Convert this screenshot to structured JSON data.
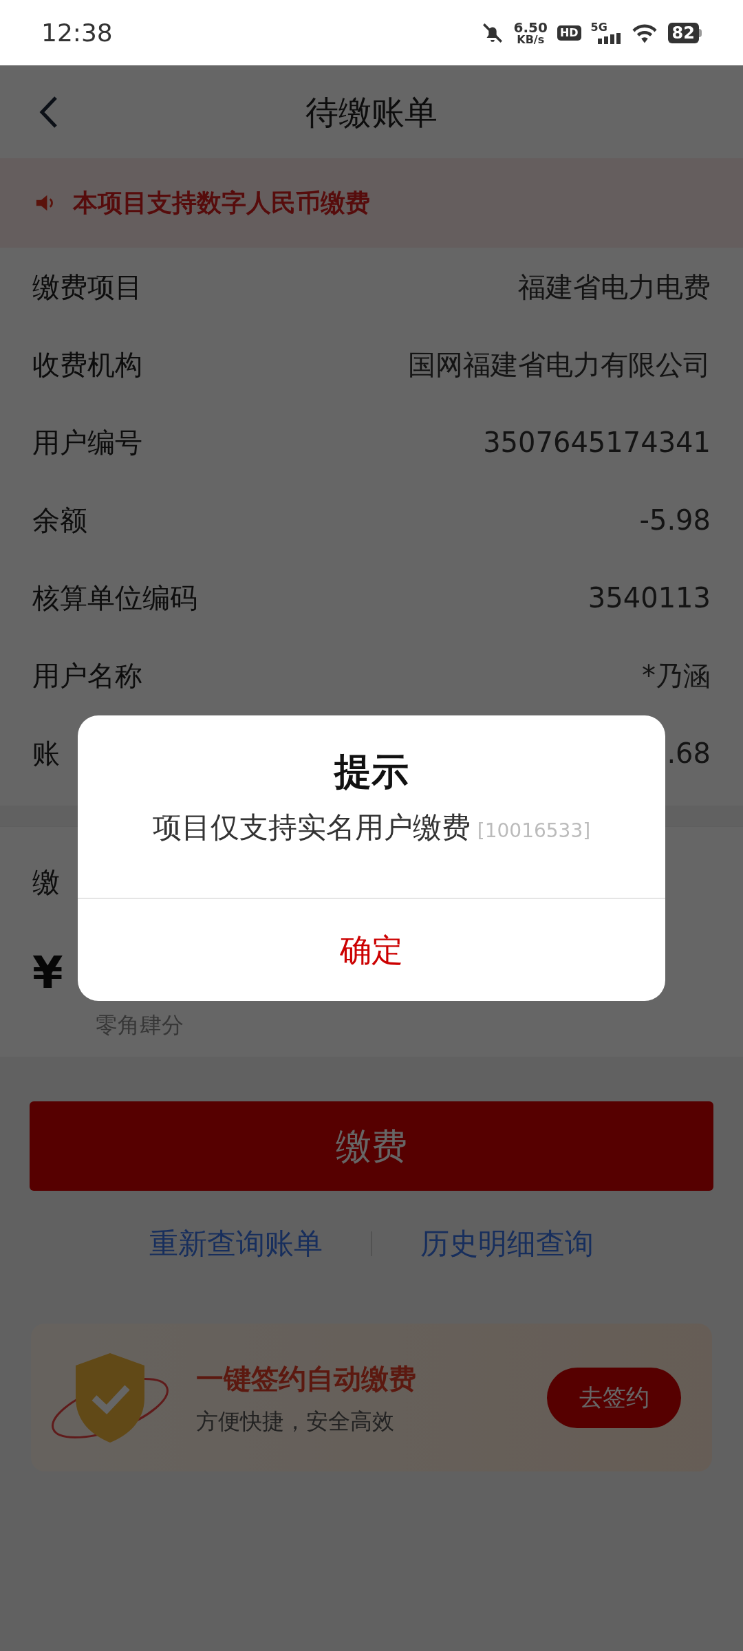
{
  "status_bar": {
    "time": "12:38",
    "net_speed": "6.50",
    "net_unit": "KB/s",
    "hd": "HD",
    "network": "5G",
    "battery": "82"
  },
  "header": {
    "title": "待缴账单"
  },
  "notice": {
    "text": "本项目支持数字人民币缴费"
  },
  "details": [
    {
      "label": "缴费项目",
      "value": "福建省电力电费"
    },
    {
      "label": "收费机构",
      "value": "国网福建省电力有限公司"
    },
    {
      "label": "用户编号",
      "value": "3507645174341"
    },
    {
      "label": "余额",
      "value": "-5.98"
    },
    {
      "label": "核算单位编码",
      "value": "3540113"
    },
    {
      "label": "用户名称",
      "value": "*乃涵"
    },
    {
      "label": "账",
      "value": ".68"
    }
  ],
  "payment": {
    "label": "缴",
    "currency": "¥",
    "amount_words": "零角肆分"
  },
  "pay_button": "缴费",
  "links": [
    "重新查询账单",
    "历史明细查询"
  ],
  "banner": {
    "title": "一键签约自动缴费",
    "subtitle": "方便快捷，安全高效",
    "button": "去签约"
  },
  "dialog": {
    "title": "提示",
    "message": "项目仅支持实名用户缴费",
    "code": "[10016533]",
    "confirm": "确定"
  }
}
